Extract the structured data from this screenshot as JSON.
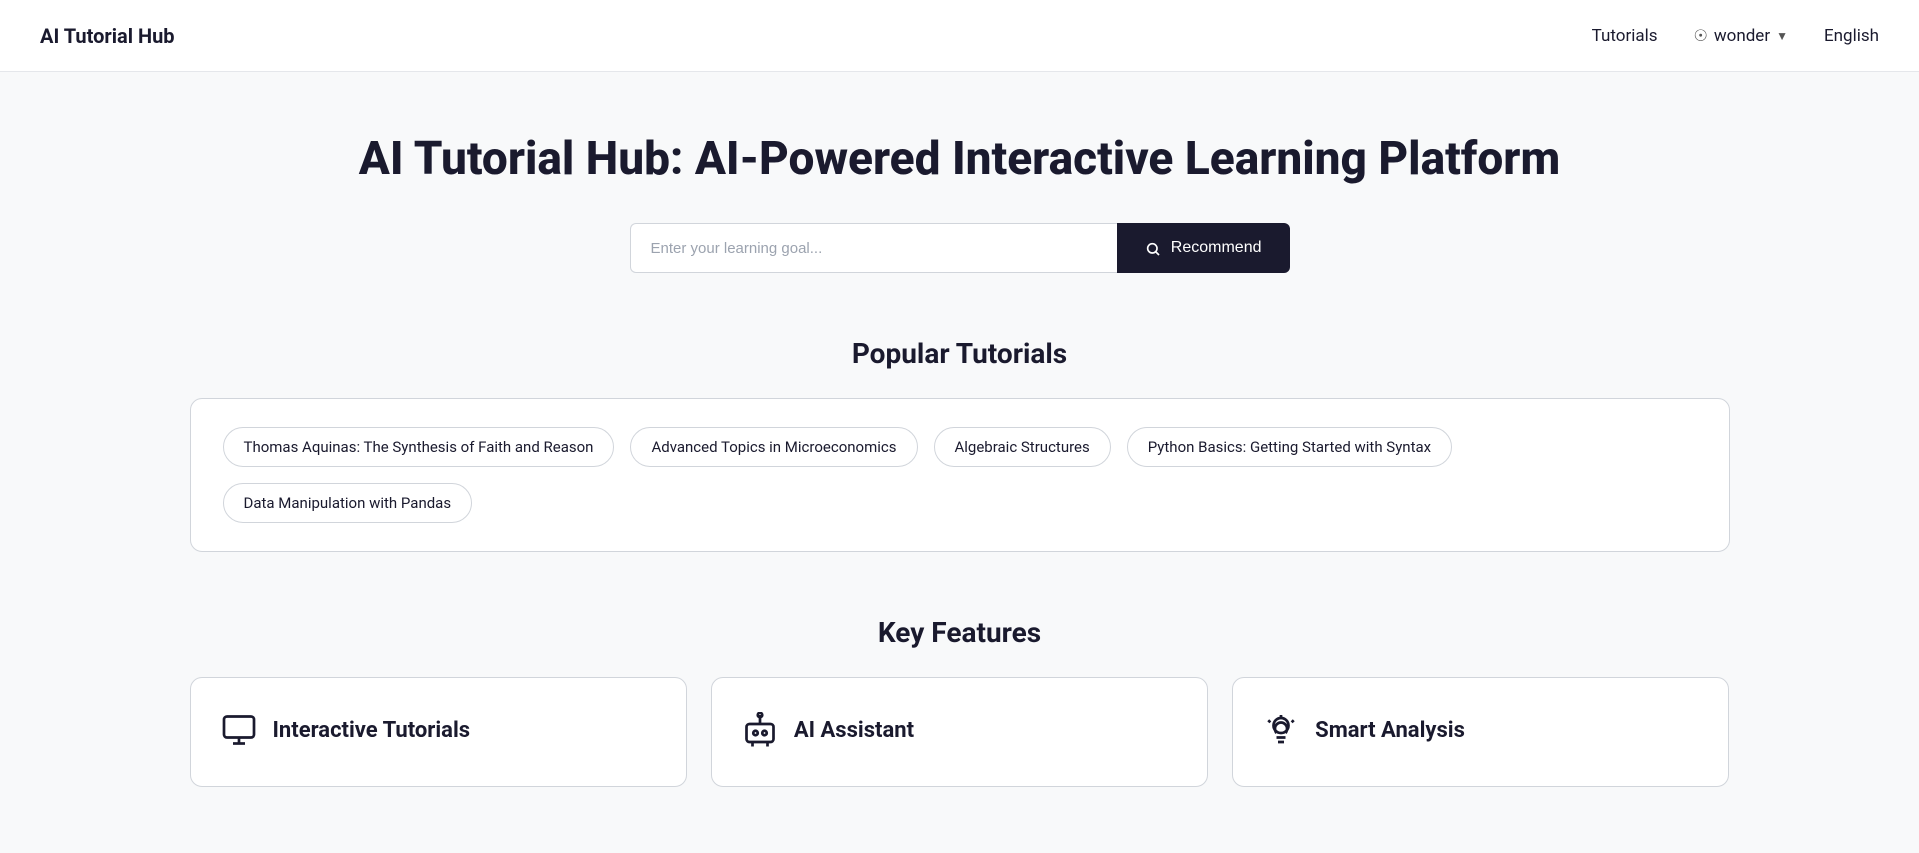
{
  "navbar": {
    "brand": "AI Tutorial Hub",
    "nav_tutorials": "Tutorials",
    "nav_user": "wonder",
    "nav_language": "English"
  },
  "hero": {
    "title": "AI Tutorial Hub: AI-Powered Interactive Learning Platform"
  },
  "search": {
    "placeholder": "Enter your learning goal...",
    "button_label": "Recommend"
  },
  "popular_tutorials": {
    "section_title": "Popular Tutorials",
    "tags": [
      "Thomas Aquinas: The Synthesis of Faith and Reason",
      "Advanced Topics in Microeconomics",
      "Algebraic Structures",
      "Python Basics: Getting Started with Syntax",
      "Data Manipulation with Pandas"
    ]
  },
  "key_features": {
    "section_title": "Key Features",
    "features": [
      {
        "id": "interactive-tutorials",
        "title": "Interactive Tutorials",
        "icon": "monitor"
      },
      {
        "id": "ai-assistant",
        "title": "AI Assistant",
        "icon": "bot"
      },
      {
        "id": "smart-analysis",
        "title": "Smart Analysis",
        "icon": "bulb"
      }
    ]
  }
}
